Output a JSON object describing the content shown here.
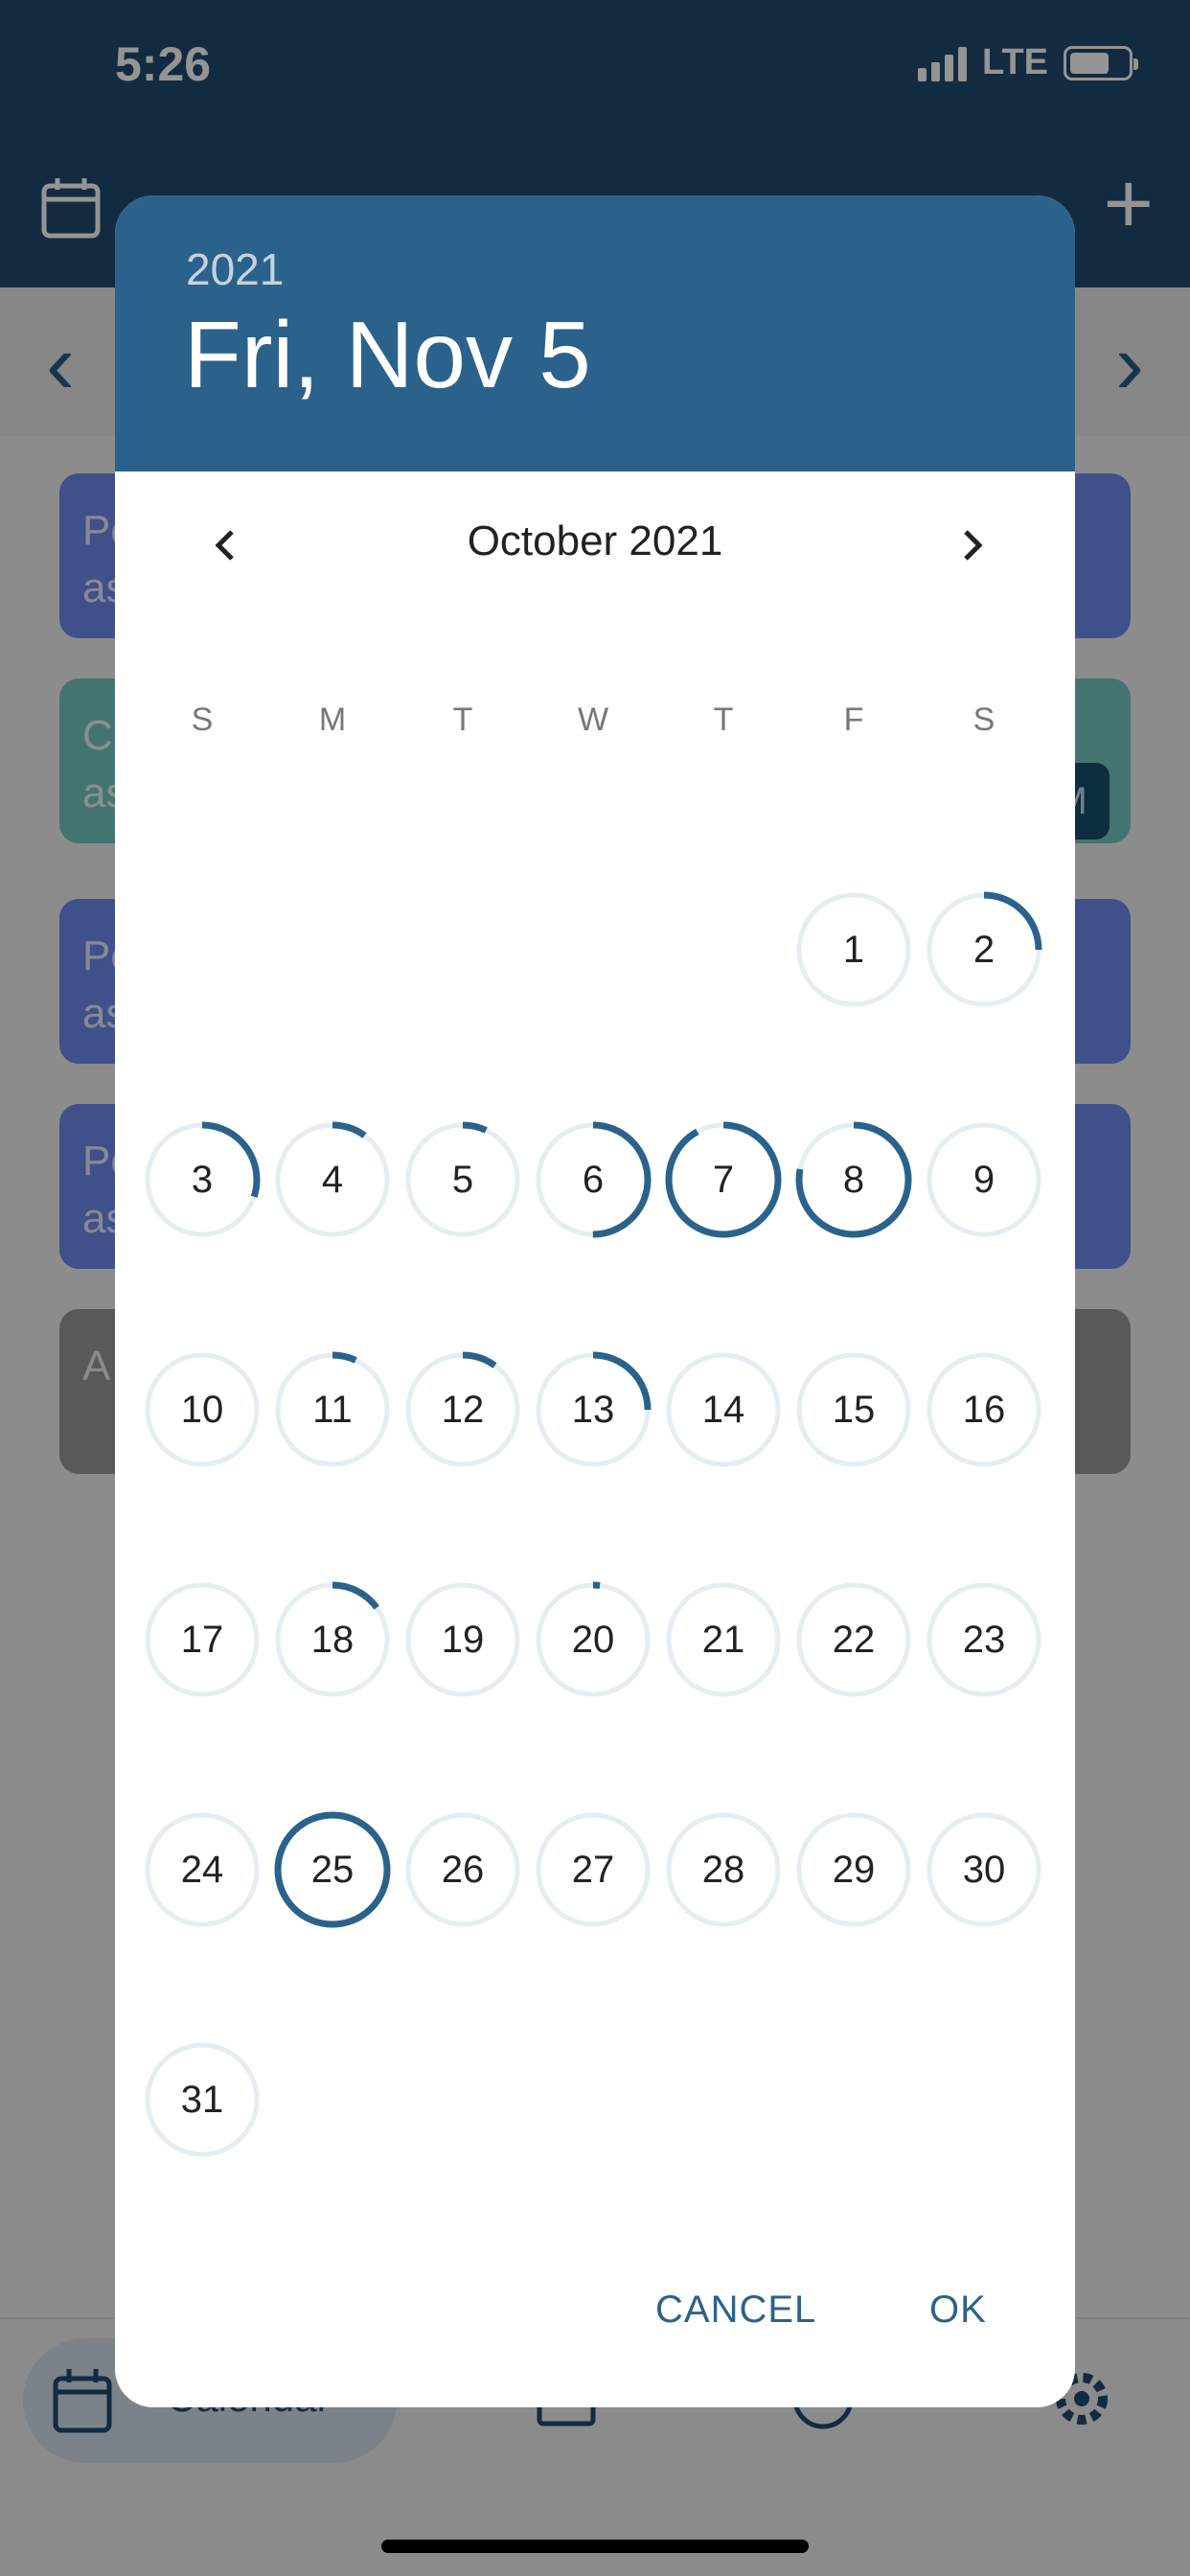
{
  "status": {
    "time": "5:26",
    "network": "LTE"
  },
  "background": {
    "nav_prev": "‹",
    "nav_next": "›",
    "events": [
      {
        "text": "Pe",
        "sub": "as",
        "color": "blue"
      },
      {
        "text": "C",
        "sub": "as",
        "color": "teal",
        "badge": "M"
      },
      {
        "text": "Pe",
        "sub": "as",
        "color": "blue"
      },
      {
        "text": "Pe",
        "sub": "as",
        "color": "blue"
      },
      {
        "text": "A",
        "sub": "",
        "color": "gray"
      }
    ],
    "tab_calendar_label": "Calendar"
  },
  "dialog": {
    "year": "2021",
    "selected_date": "Fri, Nov 5",
    "month_label": "October 2021",
    "weekdays": [
      "S",
      "M",
      "T",
      "W",
      "T",
      "F",
      "S"
    ],
    "first_weekday_index": 5,
    "days": [
      {
        "day": "1",
        "progress": 0
      },
      {
        "day": "2",
        "progress": 0.25
      },
      {
        "day": "3",
        "progress": 0.3
      },
      {
        "day": "4",
        "progress": 0.1
      },
      {
        "day": "5",
        "progress": 0.07
      },
      {
        "day": "6",
        "progress": 0.5
      },
      {
        "day": "7",
        "progress": 0.92
      },
      {
        "day": "8",
        "progress": 0.78
      },
      {
        "day": "9",
        "progress": 0
      },
      {
        "day": "10",
        "progress": 0
      },
      {
        "day": "11",
        "progress": 0.07
      },
      {
        "day": "12",
        "progress": 0.1
      },
      {
        "day": "13",
        "progress": 0.25
      },
      {
        "day": "14",
        "progress": 0
      },
      {
        "day": "15",
        "progress": 0
      },
      {
        "day": "16",
        "progress": 0
      },
      {
        "day": "17",
        "progress": 0
      },
      {
        "day": "18",
        "progress": 0.15
      },
      {
        "day": "19",
        "progress": 0
      },
      {
        "day": "20",
        "progress": 0.02
      },
      {
        "day": "21",
        "progress": 0
      },
      {
        "day": "22",
        "progress": 0
      },
      {
        "day": "23",
        "progress": 0
      },
      {
        "day": "24",
        "progress": 0
      },
      {
        "day": "25",
        "progress": 1.0
      },
      {
        "day": "26",
        "progress": 0
      },
      {
        "day": "27",
        "progress": 0
      },
      {
        "day": "28",
        "progress": 0
      },
      {
        "day": "29",
        "progress": 0
      },
      {
        "day": "30",
        "progress": 0
      },
      {
        "day": "31",
        "progress": 0
      }
    ],
    "cancel_label": "CANCEL",
    "ok_label": "OK"
  },
  "colors": {
    "header": "#2b628b",
    "ring_track": "#e6edf2",
    "ring_progress": "#2b628b",
    "app_bar": "#1f4a6f"
  },
  "icons": {
    "prev_month": "chevron-left-icon",
    "next_month": "chevron-right-icon",
    "add": "plus-icon",
    "calendar": "calendar-icon",
    "settings": "gear-icon"
  }
}
